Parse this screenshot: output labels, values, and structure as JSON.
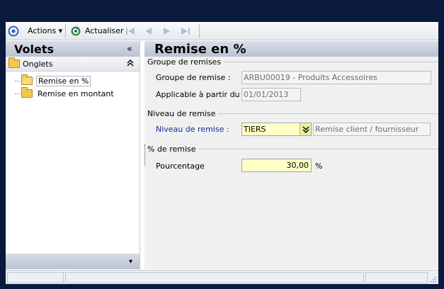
{
  "toolbar": {
    "actions_label": "Actions",
    "refresh_label": "Actualiser"
  },
  "left_panel": {
    "title": "Volets",
    "collapse_glyph": "«",
    "section_label": "Onglets",
    "section_toggle_glyph": "⌃",
    "items": [
      {
        "label": "Remise en %",
        "selected": true
      },
      {
        "label": "Remise en montant",
        "selected": false
      }
    ],
    "footer_glyph": "▾"
  },
  "main": {
    "title": "Remise en %",
    "group_remise": {
      "title": "Groupe de remises",
      "group_label": "Groupe de remise :",
      "group_value": "ARBU00019 - Produits Accessoires",
      "date_label": "Applicable à partir du :",
      "date_value": "01/01/2013"
    },
    "niveau": {
      "title": "Niveau de remise",
      "label": "Niveau de remise :",
      "value": "TIERS",
      "description": "Remise client / fournisseur"
    },
    "pourcentage": {
      "title": "% de remise",
      "label": "Pourcentage",
      "value": "30,00",
      "unit": "%"
    }
  },
  "colors": {
    "background": "#0a1a3e",
    "header_gradient": "#b8c2d2",
    "required_field": "#ffffc8",
    "blue_label": "#1a2a9a"
  }
}
